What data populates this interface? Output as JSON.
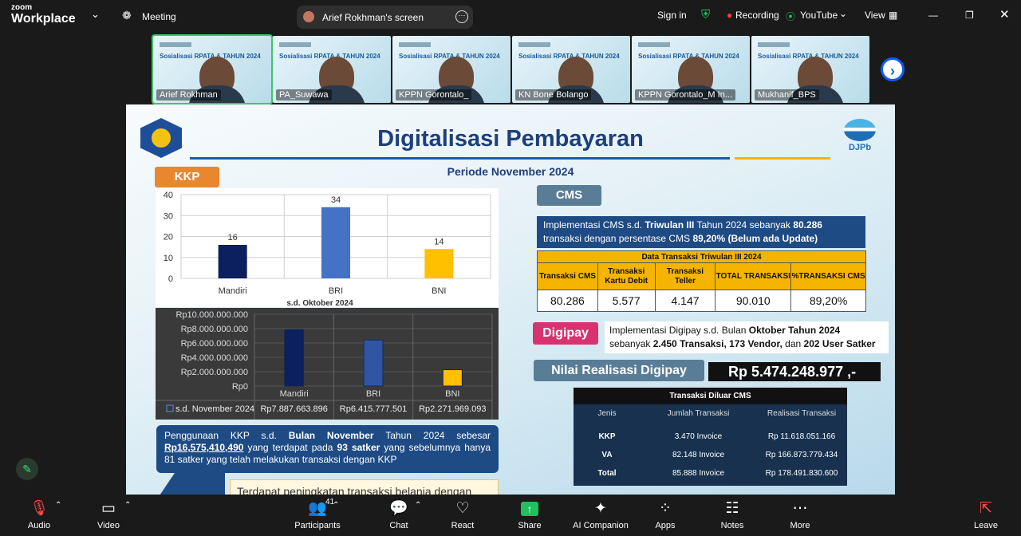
{
  "app": {
    "brand_small": "zoom",
    "brand": "Workplace",
    "meeting_label": "Meeting",
    "screen_title": "Arief Rokhman's screen",
    "sign_in": "Sign in",
    "recording": "Recording",
    "youtube": "YouTube",
    "view": "View"
  },
  "participants": [
    {
      "name": "Arief Rokhman"
    },
    {
      "name": "PA_Suwawa"
    },
    {
      "name": "KPPN Gorontalo_"
    },
    {
      "name": "KN Bone Bolango"
    },
    {
      "name": "KPPN Gorontalo_M In..."
    },
    {
      "name": "Mukhanif_BPS"
    }
  ],
  "tile_text": "Sosialisasi RPATA & TAHUN 2024",
  "slide": {
    "title": "Digitalisasi Pembayaran",
    "logo": "DJPb",
    "periode": "Periode November 2024",
    "kkp_label": "KKP",
    "cms_label": "CMS",
    "digipay_label": "Digipay",
    "nilai_label": "Nilai Realisasi Digipay",
    "nilai_value": "Rp  5.474.248.977 ,-",
    "info_kkp_1": "Penggunaan KKP s.d. ",
    "info_kkp_2": "Bulan November",
    "info_kkp_3": " Tahun 2024 sebesar ",
    "info_kkp_4": "Rp16,575,410,490",
    "info_kkp_5": " yang terdapat pada ",
    "info_kkp_6": "93 satker",
    "info_kkp_7": " yang sebelumnya hanya 81 satker yang telah melakukan transaksi dengan KKP",
    "bottom_note": "Terdapat peningkatan transaksi belanja dengan",
    "cms_1": "Implementasi CMS s.d. ",
    "cms_2": "Triwulan III",
    "cms_3": " Tahun 2024 sebanyak ",
    "cms_4": "80.286",
    "cms_5": " transaksi dengan persentase CMS ",
    "cms_6": "89,20% (Belum ada Update)",
    "cms_table": {
      "caption": "Data Transaksi Triwulan III 2024",
      "headers": [
        "Transaksi CMS",
        "Transaksi Kartu Debit",
        "Transaksi Teller",
        "TOTAL TRANSAKSI",
        "%TRANSAKSI CMS"
      ],
      "values": [
        "80.286",
        "5.577",
        "4.147",
        "90.010",
        "89,20%"
      ]
    },
    "digipay_1": "Implementasi Digipay s.d. Bulan ",
    "digipay_2": "Oktober Tahun 2024",
    "digipay_3": " sebanyak ",
    "digipay_4": "2.450 Transaksi, 173 Vendor,",
    "digipay_5": " dan ",
    "digipay_6": "202 User Satker",
    "diluar": {
      "caption": "Transaksi Diluar CMS",
      "headers": [
        "Jenis",
        "Jumlah Transaksi",
        "Realisasi Transaksi"
      ],
      "rows": [
        [
          "KKP",
          "3.470 Invoice",
          "Rp 11.618.051.166"
        ],
        [
          "VA",
          "82.148 Invoice",
          "Rp 166.873.779.434"
        ],
        [
          "Total",
          "85.888 Invoice",
          "Rp 178.491.830.600"
        ]
      ]
    }
  },
  "chart_data": [
    {
      "type": "bar",
      "categories": [
        "Mandiri",
        "BRI",
        "BNI"
      ],
      "values": [
        16,
        34,
        14
      ],
      "xlabel": "s.d. Oktober 2024",
      "ylim": [
        0,
        40
      ],
      "yticks": [
        "0",
        "10",
        "20",
        "30",
        "40"
      ],
      "colors": [
        "#0c1f5e",
        "#4472c4",
        "#ffc000"
      ],
      "grid": true
    },
    {
      "type": "bar",
      "categories": [
        "Mandiri",
        "BRI",
        "BNI"
      ],
      "values": [
        7887663896,
        6415777501,
        2271969093
      ],
      "series": [
        {
          "name": "s.d. November 2024",
          "values": [
            7887663896,
            6415777501,
            2271969093
          ]
        }
      ],
      "value_labels": [
        "Rp7.887.663.896",
        "Rp6.415.777.501",
        "Rp2.271.969.093"
      ],
      "yticks": [
        "Rp0",
        "Rp2.000.000.000",
        "Rp4.000.000.000",
        "Rp6.000.000.000",
        "Rp8.000.000.000",
        "Rp10.000.000.000"
      ],
      "ylim": [
        0,
        10000000000
      ],
      "colors": [
        "#0c1f5e",
        "#2f55a4",
        "#ffc000"
      ]
    }
  ],
  "toolbar": [
    {
      "label": "Audio",
      "icon": "mic-muted-icon"
    },
    {
      "label": "Video",
      "icon": "video-icon"
    },
    {
      "label": "Participants",
      "icon": "participants-icon",
      "count": "41"
    },
    {
      "label": "Chat",
      "icon": "chat-icon"
    },
    {
      "label": "React",
      "icon": "heart-icon"
    },
    {
      "label": "Share",
      "icon": "share-icon"
    },
    {
      "label": "AI Companion",
      "icon": "ai-companion-icon"
    },
    {
      "label": "Apps",
      "icon": "apps-icon"
    },
    {
      "label": "Notes",
      "icon": "notes-icon"
    },
    {
      "label": "More",
      "icon": "more-icon"
    },
    {
      "label": "Leave",
      "icon": "leave-icon"
    }
  ]
}
